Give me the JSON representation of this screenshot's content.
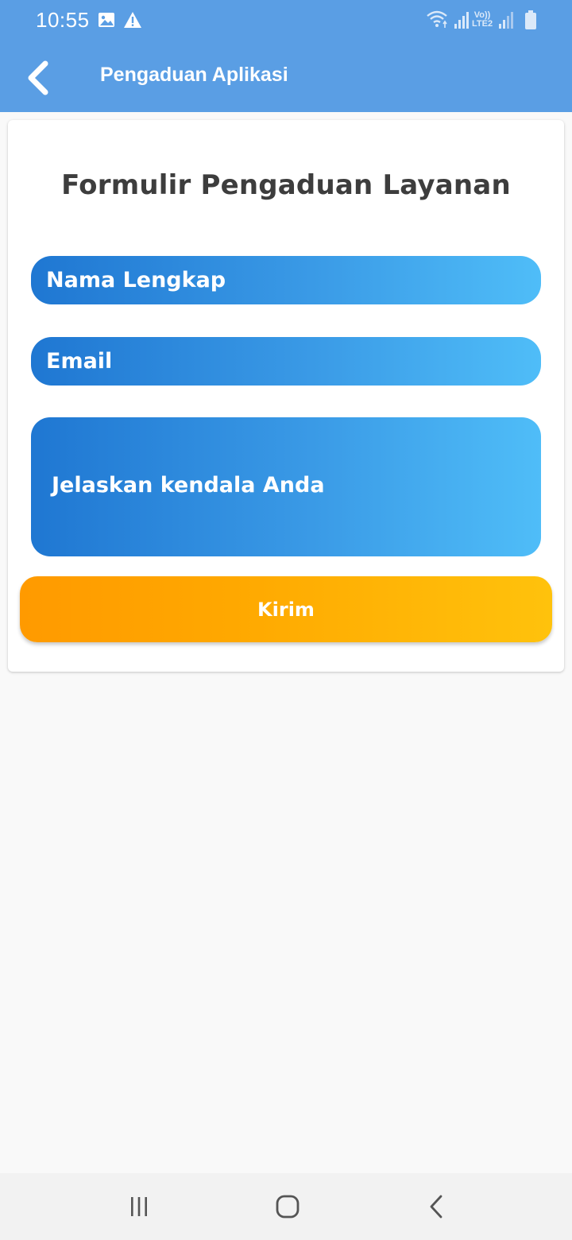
{
  "status_bar": {
    "time": "10:55",
    "icons": [
      "image-icon",
      "warning-icon",
      "wifi-icon",
      "signal-icon",
      "volte-icon",
      "signal-icon",
      "battery-icon"
    ],
    "network_label_top": "Vo))",
    "network_label_bottom": "LTE2"
  },
  "toolbar": {
    "title": "Pengaduan Aplikasi",
    "back_icon": "chevron-left-icon",
    "background": "#5a9ee4"
  },
  "form": {
    "title": "Formulir Pengaduan Layanan",
    "name_placeholder": "Nama Lengkap",
    "email_placeholder": "Email",
    "description_placeholder": "Jelaskan kendala Anda",
    "submit_label": "Kirim",
    "field_gradient": [
      "#1f77d2",
      "#4fbdf8"
    ],
    "button_gradient": [
      "#ff9a00",
      "#ffc20c"
    ]
  },
  "nav_bar": {
    "icons": [
      "recent-apps-icon",
      "home-icon",
      "back-icon"
    ]
  }
}
